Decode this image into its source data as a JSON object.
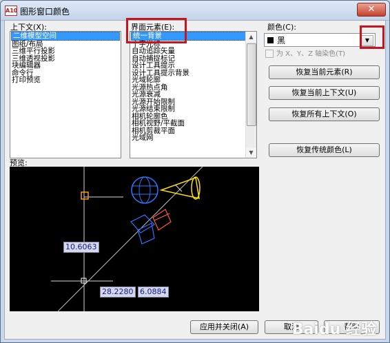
{
  "window": {
    "title": "图形窗口颜色",
    "app_icon": "A10",
    "close_label": "✕"
  },
  "context": {
    "label": "上下文(X):",
    "items": [
      "二维模型空间",
      "图纸/布局",
      "三维平行投影",
      "三维透视投影",
      "块编辑器",
      "命令行",
      "打印预览"
    ],
    "selected_index": 0
  },
  "elements": {
    "label": "界面元素(E):",
    "items": [
      "统一背景",
      "十字光标",
      "自动追踪矢量",
      "自动捕捉标记",
      "设计工具提示",
      "设计工具提示背景",
      "光域轮廓",
      "光源热点角",
      "光源衰减",
      "光源开始限制",
      "光源结束限制",
      "相机轮廓色",
      "相机视野/平截面",
      "相机剪裁平面",
      "光域网"
    ],
    "selected_index": 0
  },
  "color": {
    "label": "颜色(C):",
    "value": "黑",
    "swatch_color": "#000000",
    "tint_checkbox_label": "为 X、Y、Z 轴染色(T)",
    "tint_checked": false
  },
  "buttons": {
    "restore_element": "恢复当前元素(R)",
    "restore_context": "恢复当前上下文(U)",
    "restore_all": "恢复所有上下文(O)",
    "restore_classic": "恢复传统颜色(L)",
    "apply_close": "应用并关闭(A)",
    "cancel": "取消",
    "help": "帮助"
  },
  "preview": {
    "label": "预览:",
    "dim_vertical": "10.6063",
    "dim_x": "28.2280",
    "dim_y": "6.0884",
    "background": "#000000"
  },
  "watermark": "Baidu 经验",
  "colors": {
    "highlight": "#c8141c",
    "selection": "#3399ff"
  }
}
